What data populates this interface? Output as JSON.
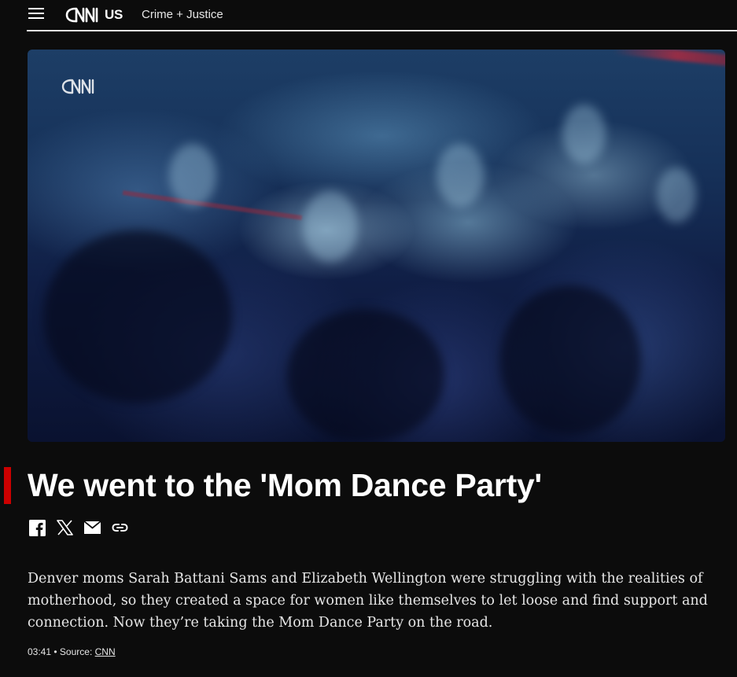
{
  "header": {
    "logo_section": "US",
    "subsection": "Crime + Justice"
  },
  "video": {
    "watermark": "CNN"
  },
  "article": {
    "headline": "We went to the 'Mom Dance Party'",
    "description": "Denver moms Sarah Battani Sams and Elizabeth Wellington were struggling with the realities of motherhood, so they created a space for women like themselves to let loose and find support and connection. Now they’re taking the Mom Dance Party on the road.",
    "duration": "03:41",
    "separator": "•",
    "source_label": "Source:",
    "source_name": "CNN"
  },
  "share": {
    "icons": [
      "facebook-icon",
      "x-icon",
      "email-icon",
      "link-icon"
    ]
  },
  "colors": {
    "background": "#0c0c0c",
    "accent": "#cc0000",
    "text": "#ffffff"
  }
}
